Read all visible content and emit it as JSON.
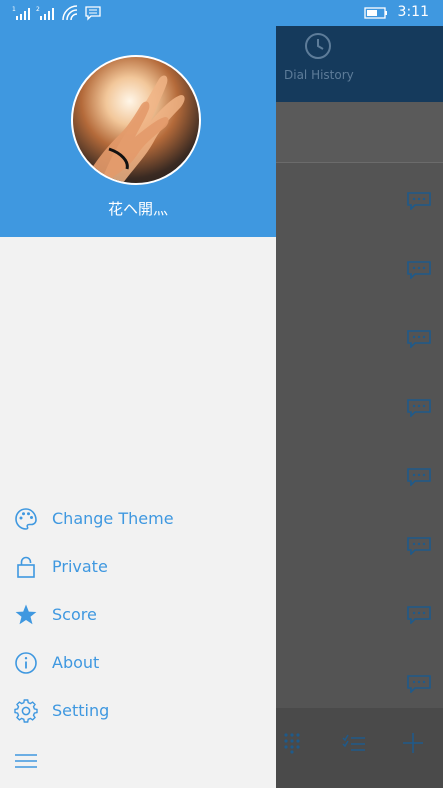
{
  "status_bar": {
    "time": "3:11"
  },
  "background_app": {
    "header_label": "Dial History"
  },
  "drawer": {
    "username": "花ヘ開灬",
    "menu": [
      {
        "label": "Change Theme",
        "icon": "palette-icon"
      },
      {
        "label": "Private",
        "icon": "lock-icon"
      },
      {
        "label": "Score",
        "icon": "star-icon"
      },
      {
        "label": "About",
        "icon": "info-icon"
      },
      {
        "label": "Setting",
        "icon": "gear-icon"
      }
    ]
  },
  "colors": {
    "accent": "#3f98e0",
    "drawer_bg": "#f2f2f2",
    "overlay": "#545454"
  }
}
